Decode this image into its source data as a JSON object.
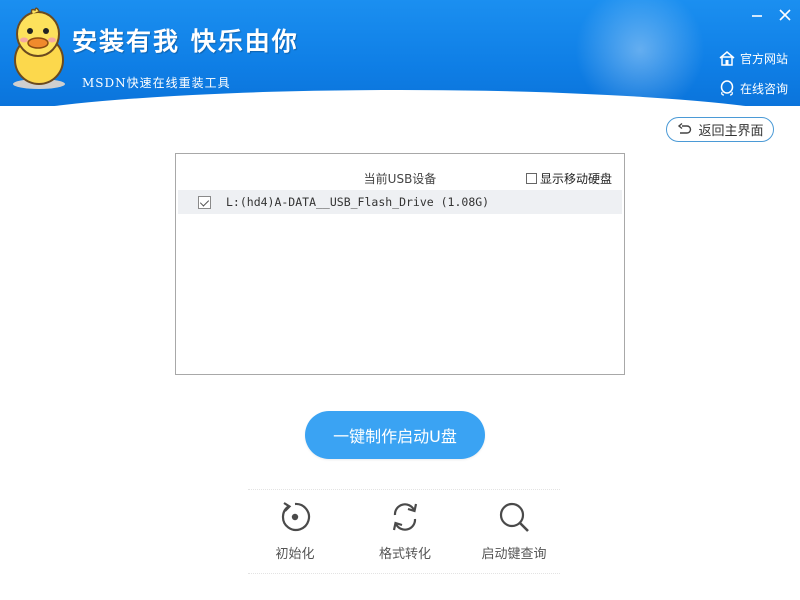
{
  "header": {
    "slogan": "安装有我  快乐由你",
    "subtitle": "MSDN快速在线重装工具",
    "minimize_icon": "minimize-icon",
    "close_icon": "close-icon",
    "links": [
      {
        "label": "官方网站",
        "icon": "home-icon"
      },
      {
        "label": "在线咨询",
        "icon": "chat-icon"
      }
    ],
    "colors": {
      "primary": "#0f7fe6"
    }
  },
  "back_button": {
    "label": "返回主界面",
    "icon": "return-icon"
  },
  "device_panel": {
    "title": "当前USB设备",
    "show_mobile_label": "显示移动硬盘",
    "show_mobile_checked": false,
    "devices": [
      {
        "label": "L:(hd4)A-DATA__USB_Flash_Drive (1.08G)",
        "checked": true
      }
    ]
  },
  "make_button": {
    "label": "一键制作启动U盘",
    "color": "#3aa3f3"
  },
  "tools": [
    {
      "label": "初始化",
      "icon": "reset-icon"
    },
    {
      "label": "格式转化",
      "icon": "convert-icon"
    },
    {
      "label": "启动键查询",
      "icon": "search-icon"
    }
  ]
}
